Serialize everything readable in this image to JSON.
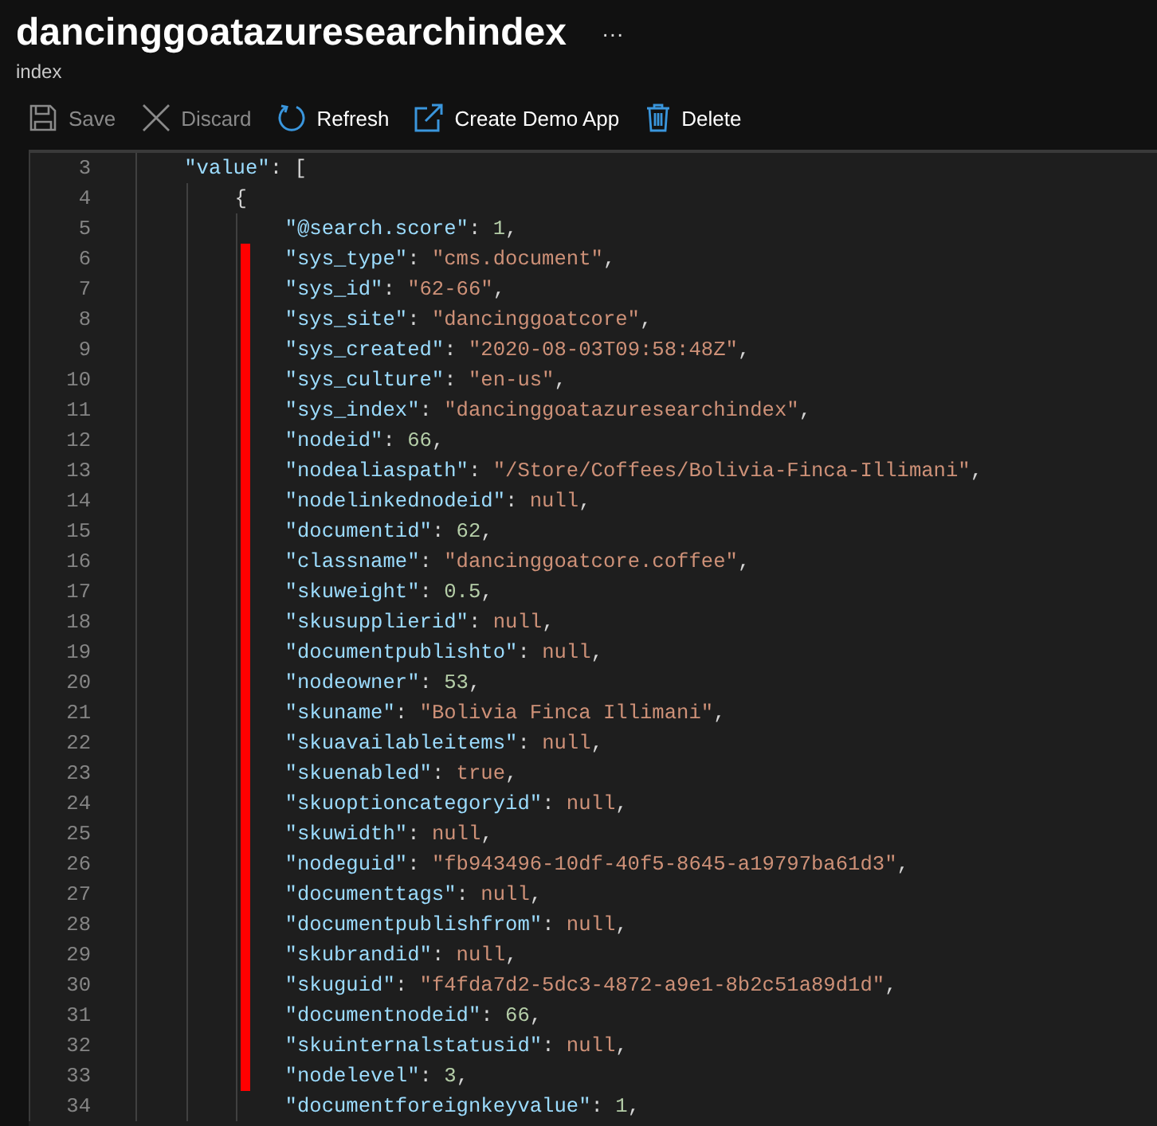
{
  "header": {
    "title": "dancinggoatazuresearchindex",
    "more": "···",
    "subtitle": "index"
  },
  "toolbar": [
    {
      "kind": "save",
      "label": "Save",
      "disabled": true
    },
    {
      "kind": "discard",
      "label": "Discard",
      "disabled": true
    },
    {
      "kind": "refresh",
      "label": "Refresh",
      "disabled": false
    },
    {
      "kind": "external",
      "label": "Create Demo App",
      "disabled": false
    },
    {
      "kind": "delete",
      "label": "Delete",
      "disabled": false
    }
  ],
  "code": {
    "lines": [
      {
        "number": "3",
        "highlighted": false,
        "tokens": [
          {
            "kind": "key",
            "text": "\"value\""
          },
          {
            "kind": "punct",
            "text": ": ["
          }
        ],
        "children": [
          {
            "number": "4",
            "highlighted": false,
            "tokens": [
              {
                "kind": "punct",
                "text": "{"
              }
            ],
            "children": [
              {
                "number": "5",
                "highlighted": false,
                "tokens": [
                  {
                    "kind": "key",
                    "text": "\"@search.score\""
                  },
                  {
                    "kind": "punct",
                    "text": ": "
                  },
                  {
                    "kind": "number",
                    "text": "1"
                  },
                  {
                    "kind": "punct",
                    "text": ","
                  }
                ]
              },
              {
                "number": "6",
                "highlighted": true,
                "tokens": [
                  {
                    "kind": "key",
                    "text": "\"sys_type\""
                  },
                  {
                    "kind": "punct",
                    "text": ": "
                  },
                  {
                    "kind": "string",
                    "text": "\"cms.document\""
                  },
                  {
                    "kind": "punct",
                    "text": ","
                  }
                ]
              },
              {
                "number": "7",
                "highlighted": true,
                "tokens": [
                  {
                    "kind": "key",
                    "text": "\"sys_id\""
                  },
                  {
                    "kind": "punct",
                    "text": ": "
                  },
                  {
                    "kind": "string",
                    "text": "\"62-66\""
                  },
                  {
                    "kind": "punct",
                    "text": ","
                  }
                ]
              },
              {
                "number": "8",
                "highlighted": true,
                "tokens": [
                  {
                    "kind": "key",
                    "text": "\"sys_site\""
                  },
                  {
                    "kind": "punct",
                    "text": ": "
                  },
                  {
                    "kind": "string",
                    "text": "\"dancinggoatcore\""
                  },
                  {
                    "kind": "punct",
                    "text": ","
                  }
                ]
              },
              {
                "number": "9",
                "highlighted": true,
                "tokens": [
                  {
                    "kind": "key",
                    "text": "\"sys_created\""
                  },
                  {
                    "kind": "punct",
                    "text": ": "
                  },
                  {
                    "kind": "string",
                    "text": "\"2020-08-03T09:58:48Z\""
                  },
                  {
                    "kind": "punct",
                    "text": ","
                  }
                ]
              },
              {
                "number": "10",
                "highlighted": true,
                "tokens": [
                  {
                    "kind": "key",
                    "text": "\"sys_culture\""
                  },
                  {
                    "kind": "punct",
                    "text": ": "
                  },
                  {
                    "kind": "string",
                    "text": "\"en-us\""
                  },
                  {
                    "kind": "punct",
                    "text": ","
                  }
                ]
              },
              {
                "number": "11",
                "highlighted": true,
                "tokens": [
                  {
                    "kind": "key",
                    "text": "\"sys_index\""
                  },
                  {
                    "kind": "punct",
                    "text": ": "
                  },
                  {
                    "kind": "string",
                    "text": "\"dancinggoatazuresearchindex\""
                  },
                  {
                    "kind": "punct",
                    "text": ","
                  }
                ]
              },
              {
                "number": "12",
                "highlighted": true,
                "tokens": [
                  {
                    "kind": "key",
                    "text": "\"nodeid\""
                  },
                  {
                    "kind": "punct",
                    "text": ": "
                  },
                  {
                    "kind": "number",
                    "text": "66"
                  },
                  {
                    "kind": "punct",
                    "text": ","
                  }
                ]
              },
              {
                "number": "13",
                "highlighted": true,
                "tokens": [
                  {
                    "kind": "key",
                    "text": "\"nodealiaspath\""
                  },
                  {
                    "kind": "punct",
                    "text": ": "
                  },
                  {
                    "kind": "string",
                    "text": "\"/Store/Coffees/Bolivia-Finca-Illimani\""
                  },
                  {
                    "kind": "punct",
                    "text": ","
                  }
                ]
              },
              {
                "number": "14",
                "highlighted": true,
                "tokens": [
                  {
                    "kind": "key",
                    "text": "\"nodelinkednodeid\""
                  },
                  {
                    "kind": "punct",
                    "text": ": "
                  },
                  {
                    "kind": "literal",
                    "text": "null"
                  },
                  {
                    "kind": "punct",
                    "text": ","
                  }
                ]
              },
              {
                "number": "15",
                "highlighted": true,
                "tokens": [
                  {
                    "kind": "key",
                    "text": "\"documentid\""
                  },
                  {
                    "kind": "punct",
                    "text": ": "
                  },
                  {
                    "kind": "number",
                    "text": "62"
                  },
                  {
                    "kind": "punct",
                    "text": ","
                  }
                ]
              },
              {
                "number": "16",
                "highlighted": true,
                "tokens": [
                  {
                    "kind": "key",
                    "text": "\"classname\""
                  },
                  {
                    "kind": "punct",
                    "text": ": "
                  },
                  {
                    "kind": "string",
                    "text": "\"dancinggoatcore.coffee\""
                  },
                  {
                    "kind": "punct",
                    "text": ","
                  }
                ]
              },
              {
                "number": "17",
                "highlighted": true,
                "tokens": [
                  {
                    "kind": "key",
                    "text": "\"skuweight\""
                  },
                  {
                    "kind": "punct",
                    "text": ": "
                  },
                  {
                    "kind": "number",
                    "text": "0.5"
                  },
                  {
                    "kind": "punct",
                    "text": ","
                  }
                ]
              },
              {
                "number": "18",
                "highlighted": true,
                "tokens": [
                  {
                    "kind": "key",
                    "text": "\"skusupplierid\""
                  },
                  {
                    "kind": "punct",
                    "text": ": "
                  },
                  {
                    "kind": "literal",
                    "text": "null"
                  },
                  {
                    "kind": "punct",
                    "text": ","
                  }
                ]
              },
              {
                "number": "19",
                "highlighted": true,
                "tokens": [
                  {
                    "kind": "key",
                    "text": "\"documentpublishto\""
                  },
                  {
                    "kind": "punct",
                    "text": ": "
                  },
                  {
                    "kind": "literal",
                    "text": "null"
                  },
                  {
                    "kind": "punct",
                    "text": ","
                  }
                ]
              },
              {
                "number": "20",
                "highlighted": true,
                "tokens": [
                  {
                    "kind": "key",
                    "text": "\"nodeowner\""
                  },
                  {
                    "kind": "punct",
                    "text": ": "
                  },
                  {
                    "kind": "number",
                    "text": "53"
                  },
                  {
                    "kind": "punct",
                    "text": ","
                  }
                ]
              },
              {
                "number": "21",
                "highlighted": true,
                "tokens": [
                  {
                    "kind": "key",
                    "text": "\"skuname\""
                  },
                  {
                    "kind": "punct",
                    "text": ": "
                  },
                  {
                    "kind": "string",
                    "text": "\"Bolivia Finca Illimani\""
                  },
                  {
                    "kind": "punct",
                    "text": ","
                  }
                ]
              },
              {
                "number": "22",
                "highlighted": true,
                "tokens": [
                  {
                    "kind": "key",
                    "text": "\"skuavailableitems\""
                  },
                  {
                    "kind": "punct",
                    "text": ": "
                  },
                  {
                    "kind": "literal",
                    "text": "null"
                  },
                  {
                    "kind": "punct",
                    "text": ","
                  }
                ]
              },
              {
                "number": "23",
                "highlighted": true,
                "tokens": [
                  {
                    "kind": "key",
                    "text": "\"skuenabled\""
                  },
                  {
                    "kind": "punct",
                    "text": ": "
                  },
                  {
                    "kind": "literal",
                    "text": "true"
                  },
                  {
                    "kind": "punct",
                    "text": ","
                  }
                ]
              },
              {
                "number": "24",
                "highlighted": true,
                "tokens": [
                  {
                    "kind": "key",
                    "text": "\"skuoptioncategoryid\""
                  },
                  {
                    "kind": "punct",
                    "text": ": "
                  },
                  {
                    "kind": "literal",
                    "text": "null"
                  },
                  {
                    "kind": "punct",
                    "text": ","
                  }
                ]
              },
              {
                "number": "25",
                "highlighted": true,
                "tokens": [
                  {
                    "kind": "key",
                    "text": "\"skuwidth\""
                  },
                  {
                    "kind": "punct",
                    "text": ": "
                  },
                  {
                    "kind": "literal",
                    "text": "null"
                  },
                  {
                    "kind": "punct",
                    "text": ","
                  }
                ]
              },
              {
                "number": "26",
                "highlighted": true,
                "tokens": [
                  {
                    "kind": "key",
                    "text": "\"nodeguid\""
                  },
                  {
                    "kind": "punct",
                    "text": ": "
                  },
                  {
                    "kind": "string",
                    "text": "\"fb943496-10df-40f5-8645-a19797ba61d3\""
                  },
                  {
                    "kind": "punct",
                    "text": ","
                  }
                ]
              },
              {
                "number": "27",
                "highlighted": true,
                "tokens": [
                  {
                    "kind": "key",
                    "text": "\"documenttags\""
                  },
                  {
                    "kind": "punct",
                    "text": ": "
                  },
                  {
                    "kind": "literal",
                    "text": "null"
                  },
                  {
                    "kind": "punct",
                    "text": ","
                  }
                ]
              },
              {
                "number": "28",
                "highlighted": true,
                "tokens": [
                  {
                    "kind": "key",
                    "text": "\"documentpublishfrom\""
                  },
                  {
                    "kind": "punct",
                    "text": ": "
                  },
                  {
                    "kind": "literal",
                    "text": "null"
                  },
                  {
                    "kind": "punct",
                    "text": ","
                  }
                ]
              },
              {
                "number": "29",
                "highlighted": true,
                "tokens": [
                  {
                    "kind": "key",
                    "text": "\"skubrandid\""
                  },
                  {
                    "kind": "punct",
                    "text": ": "
                  },
                  {
                    "kind": "literal",
                    "text": "null"
                  },
                  {
                    "kind": "punct",
                    "text": ","
                  }
                ]
              },
              {
                "number": "30",
                "highlighted": true,
                "tokens": [
                  {
                    "kind": "key",
                    "text": "\"skuguid\""
                  },
                  {
                    "kind": "punct",
                    "text": ": "
                  },
                  {
                    "kind": "string",
                    "text": "\"f4fda7d2-5dc3-4872-a9e1-8b2c51a89d1d\""
                  },
                  {
                    "kind": "punct",
                    "text": ","
                  }
                ]
              },
              {
                "number": "31",
                "highlighted": true,
                "tokens": [
                  {
                    "kind": "key",
                    "text": "\"documentnodeid\""
                  },
                  {
                    "kind": "punct",
                    "text": ": "
                  },
                  {
                    "kind": "number",
                    "text": "66"
                  },
                  {
                    "kind": "punct",
                    "text": ","
                  }
                ]
              },
              {
                "number": "32",
                "highlighted": true,
                "tokens": [
                  {
                    "kind": "key",
                    "text": "\"skuinternalstatusid\""
                  },
                  {
                    "kind": "punct",
                    "text": ": "
                  },
                  {
                    "kind": "literal",
                    "text": "null"
                  },
                  {
                    "kind": "punct",
                    "text": ","
                  }
                ]
              },
              {
                "number": "33",
                "highlighted": true,
                "tokens": [
                  {
                    "kind": "key",
                    "text": "\"nodelevel\""
                  },
                  {
                    "kind": "punct",
                    "text": ": "
                  },
                  {
                    "kind": "number",
                    "text": "3"
                  },
                  {
                    "kind": "punct",
                    "text": ","
                  }
                ]
              },
              {
                "number": "34",
                "highlighted": false,
                "tokens": [
                  {
                    "kind": "key",
                    "text": "\"documentforeignkeyvalue\""
                  },
                  {
                    "kind": "punct",
                    "text": ": "
                  },
                  {
                    "kind": "number",
                    "text": "1"
                  },
                  {
                    "kind": "punct",
                    "text": ","
                  }
                ]
              }
            ]
          }
        ]
      }
    ]
  }
}
